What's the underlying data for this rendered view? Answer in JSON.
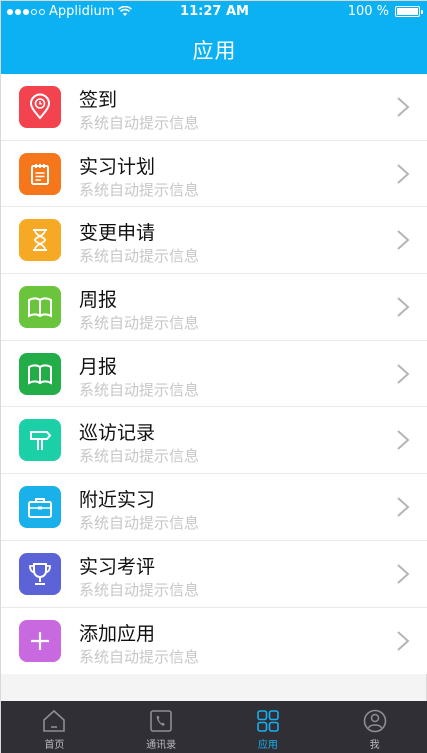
{
  "status_bar": {
    "carrier": "Applidium",
    "time": "11:27 AM",
    "battery": "100 %"
  },
  "header": {
    "title": "应用"
  },
  "list": {
    "items": [
      {
        "title": "签到",
        "subtitle": "系统自动提示信息",
        "icon": "location-pin-icon",
        "color": "#f2434f"
      },
      {
        "title": "实习计划",
        "subtitle": "系统自动提示信息",
        "icon": "notepad-icon",
        "color": "#f6771b"
      },
      {
        "title": "变更申请",
        "subtitle": "系统自动提示信息",
        "icon": "hourglass-icon",
        "color": "#f6a924"
      },
      {
        "title": "周报",
        "subtitle": "系统自动提示信息",
        "icon": "book-icon",
        "color": "#6ac43c"
      },
      {
        "title": "月报",
        "subtitle": "系统自动提示信息",
        "icon": "book-icon",
        "color": "#22ad48"
      },
      {
        "title": "巡访记录",
        "subtitle": "系统自动提示信息",
        "icon": "signpost-icon",
        "color": "#1bcfa6"
      },
      {
        "title": "附近实习",
        "subtitle": "系统自动提示信息",
        "icon": "briefcase-icon",
        "color": "#1ab1ea"
      },
      {
        "title": "实习考评",
        "subtitle": "系统自动提示信息",
        "icon": "trophy-icon",
        "color": "#5c63d6"
      },
      {
        "title": "添加应用",
        "subtitle": "系统自动提示信息",
        "icon": "plus-icon",
        "color": "#c869e0"
      }
    ]
  },
  "tabbar": {
    "tabs": [
      {
        "label": "首页",
        "icon": "home-icon",
        "active": false
      },
      {
        "label": "通讯录",
        "icon": "phone-book-icon",
        "active": false
      },
      {
        "label": "应用",
        "icon": "apps-grid-icon",
        "active": true
      },
      {
        "label": "我",
        "icon": "user-icon",
        "active": false
      }
    ],
    "active_color": "#17b0f0"
  }
}
